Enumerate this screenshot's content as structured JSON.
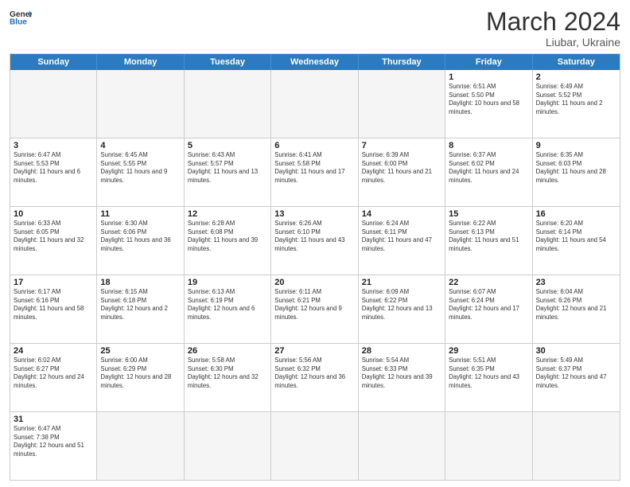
{
  "header": {
    "logo_general": "General",
    "logo_blue": "Blue",
    "title": "March 2024",
    "subtitle": "Liubar, Ukraine"
  },
  "days_of_week": [
    "Sunday",
    "Monday",
    "Tuesday",
    "Wednesday",
    "Thursday",
    "Friday",
    "Saturday"
  ],
  "weeks": [
    [
      {
        "day": "",
        "info": ""
      },
      {
        "day": "",
        "info": ""
      },
      {
        "day": "",
        "info": ""
      },
      {
        "day": "",
        "info": ""
      },
      {
        "day": "",
        "info": ""
      },
      {
        "day": "1",
        "info": "Sunrise: 6:51 AM\nSunset: 5:50 PM\nDaylight: 10 hours and 58 minutes."
      },
      {
        "day": "2",
        "info": "Sunrise: 6:49 AM\nSunset: 5:52 PM\nDaylight: 11 hours and 2 minutes."
      }
    ],
    [
      {
        "day": "3",
        "info": "Sunrise: 6:47 AM\nSunset: 5:53 PM\nDaylight: 11 hours and 6 minutes."
      },
      {
        "day": "4",
        "info": "Sunrise: 6:45 AM\nSunset: 5:55 PM\nDaylight: 11 hours and 9 minutes."
      },
      {
        "day": "5",
        "info": "Sunrise: 6:43 AM\nSunset: 5:57 PM\nDaylight: 11 hours and 13 minutes."
      },
      {
        "day": "6",
        "info": "Sunrise: 6:41 AM\nSunset: 5:58 PM\nDaylight: 11 hours and 17 minutes."
      },
      {
        "day": "7",
        "info": "Sunrise: 6:39 AM\nSunset: 6:00 PM\nDaylight: 11 hours and 21 minutes."
      },
      {
        "day": "8",
        "info": "Sunrise: 6:37 AM\nSunset: 6:02 PM\nDaylight: 11 hours and 24 minutes."
      },
      {
        "day": "9",
        "info": "Sunrise: 6:35 AM\nSunset: 6:03 PM\nDaylight: 11 hours and 28 minutes."
      }
    ],
    [
      {
        "day": "10",
        "info": "Sunrise: 6:33 AM\nSunset: 6:05 PM\nDaylight: 11 hours and 32 minutes."
      },
      {
        "day": "11",
        "info": "Sunrise: 6:30 AM\nSunset: 6:06 PM\nDaylight: 11 hours and 36 minutes."
      },
      {
        "day": "12",
        "info": "Sunrise: 6:28 AM\nSunset: 6:08 PM\nDaylight: 11 hours and 39 minutes."
      },
      {
        "day": "13",
        "info": "Sunrise: 6:26 AM\nSunset: 6:10 PM\nDaylight: 11 hours and 43 minutes."
      },
      {
        "day": "14",
        "info": "Sunrise: 6:24 AM\nSunset: 6:11 PM\nDaylight: 11 hours and 47 minutes."
      },
      {
        "day": "15",
        "info": "Sunrise: 6:22 AM\nSunset: 6:13 PM\nDaylight: 11 hours and 51 minutes."
      },
      {
        "day": "16",
        "info": "Sunrise: 6:20 AM\nSunset: 6:14 PM\nDaylight: 11 hours and 54 minutes."
      }
    ],
    [
      {
        "day": "17",
        "info": "Sunrise: 6:17 AM\nSunset: 6:16 PM\nDaylight: 11 hours and 58 minutes."
      },
      {
        "day": "18",
        "info": "Sunrise: 6:15 AM\nSunset: 6:18 PM\nDaylight: 12 hours and 2 minutes."
      },
      {
        "day": "19",
        "info": "Sunrise: 6:13 AM\nSunset: 6:19 PM\nDaylight: 12 hours and 6 minutes."
      },
      {
        "day": "20",
        "info": "Sunrise: 6:11 AM\nSunset: 6:21 PM\nDaylight: 12 hours and 9 minutes."
      },
      {
        "day": "21",
        "info": "Sunrise: 6:09 AM\nSunset: 6:22 PM\nDaylight: 12 hours and 13 minutes."
      },
      {
        "day": "22",
        "info": "Sunrise: 6:07 AM\nSunset: 6:24 PM\nDaylight: 12 hours and 17 minutes."
      },
      {
        "day": "23",
        "info": "Sunrise: 6:04 AM\nSunset: 6:26 PM\nDaylight: 12 hours and 21 minutes."
      }
    ],
    [
      {
        "day": "24",
        "info": "Sunrise: 6:02 AM\nSunset: 6:27 PM\nDaylight: 12 hours and 24 minutes."
      },
      {
        "day": "25",
        "info": "Sunrise: 6:00 AM\nSunset: 6:29 PM\nDaylight: 12 hours and 28 minutes."
      },
      {
        "day": "26",
        "info": "Sunrise: 5:58 AM\nSunset: 6:30 PM\nDaylight: 12 hours and 32 minutes."
      },
      {
        "day": "27",
        "info": "Sunrise: 5:56 AM\nSunset: 6:32 PM\nDaylight: 12 hours and 36 minutes."
      },
      {
        "day": "28",
        "info": "Sunrise: 5:54 AM\nSunset: 6:33 PM\nDaylight: 12 hours and 39 minutes."
      },
      {
        "day": "29",
        "info": "Sunrise: 5:51 AM\nSunset: 6:35 PM\nDaylight: 12 hours and 43 minutes."
      },
      {
        "day": "30",
        "info": "Sunrise: 5:49 AM\nSunset: 6:37 PM\nDaylight: 12 hours and 47 minutes."
      }
    ],
    [
      {
        "day": "31",
        "info": "Sunrise: 6:47 AM\nSunset: 7:38 PM\nDaylight: 12 hours and 51 minutes."
      },
      {
        "day": "",
        "info": ""
      },
      {
        "day": "",
        "info": ""
      },
      {
        "day": "",
        "info": ""
      },
      {
        "day": "",
        "info": ""
      },
      {
        "day": "",
        "info": ""
      },
      {
        "day": "",
        "info": ""
      }
    ]
  ]
}
